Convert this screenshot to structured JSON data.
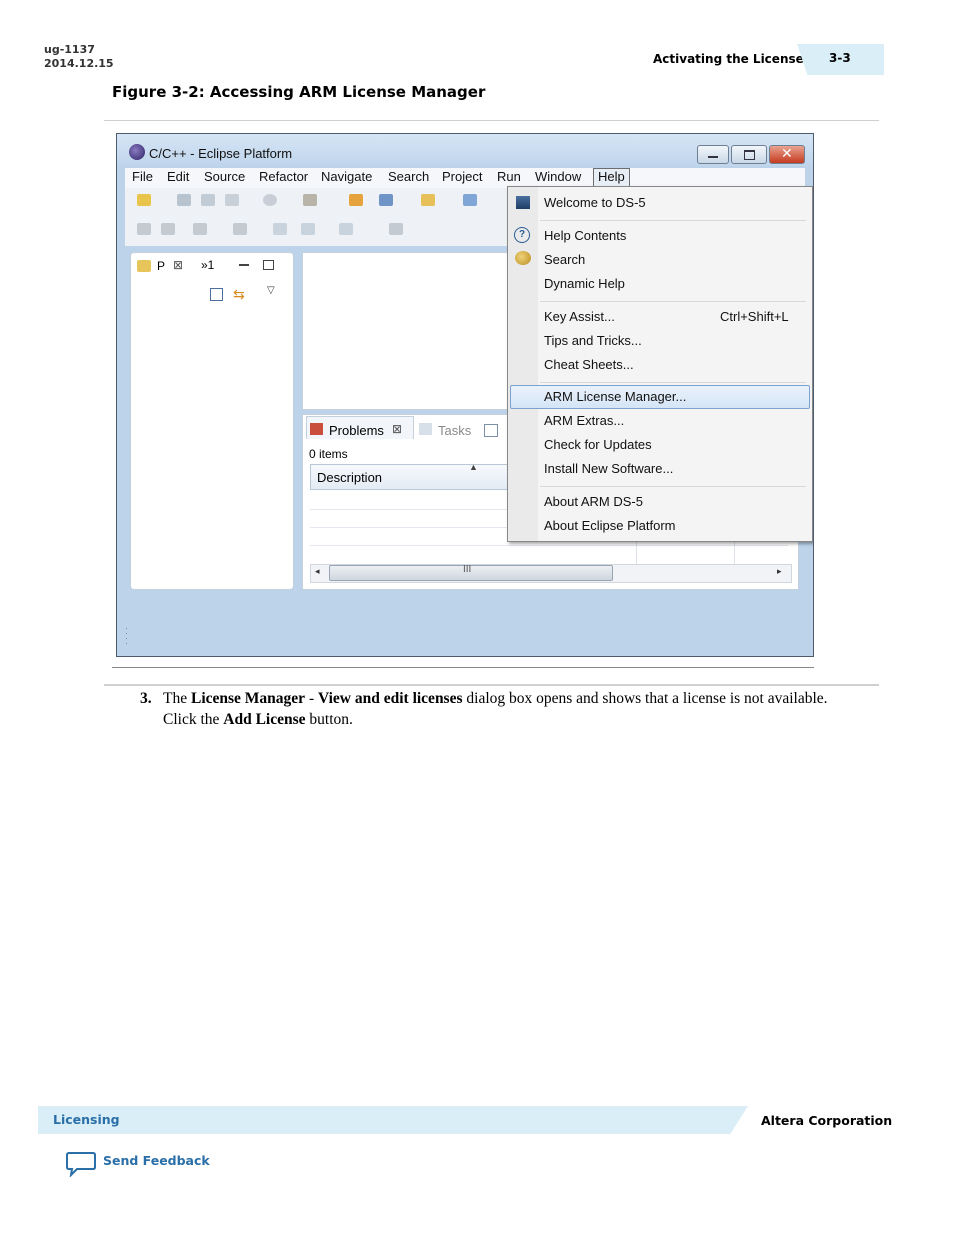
{
  "header": {
    "doc_id": "ug-1137",
    "doc_date": "2014.12.15",
    "section_title": "Activating the License",
    "page_number": "3-3"
  },
  "figure": {
    "caption": "Figure 3-2: Accessing ARM License Manager"
  },
  "screenshot": {
    "window_title": "C/C++ - Eclipse Platform",
    "menu": [
      "File",
      "Edit",
      "Source",
      "Refactor",
      "Navigate",
      "Search",
      "Project",
      "Run",
      "Window",
      "Help"
    ],
    "left_tab_label": "P",
    "left_tab_count": "»1",
    "problems_tab": "Problems",
    "tasks_tab": "Tasks",
    "items_count": "0 items",
    "column_header": "Description",
    "scroll_grip": "III",
    "help_menu": {
      "items": [
        "Welcome to DS-5",
        "Help Contents",
        "Search",
        "Dynamic Help",
        "Key Assist...",
        "Tips and Tricks...",
        "Cheat Sheets...",
        "ARM License Manager...",
        "ARM Extras...",
        "Check for Updates",
        "Install New Software...",
        "About ARM DS-5",
        "About Eclipse Platform"
      ],
      "key_assist_shortcut": "Ctrl+Shift+L",
      "highlighted": "ARM License Manager..."
    }
  },
  "step": {
    "number": "3.",
    "t1": "The ",
    "b1": "License Manager",
    "t2": " - ",
    "b2": "View and edit licenses",
    "t3": " dialog box opens and shows that a license is not available. Click the ",
    "b3": "Add License",
    "t4": " button."
  },
  "footer": {
    "section": "Licensing",
    "company": "Altera Corporation",
    "feedback": "Send Feedback"
  },
  "colors": {
    "accent_band": "#d9eef7",
    "link_blue": "#2a6fa8"
  }
}
